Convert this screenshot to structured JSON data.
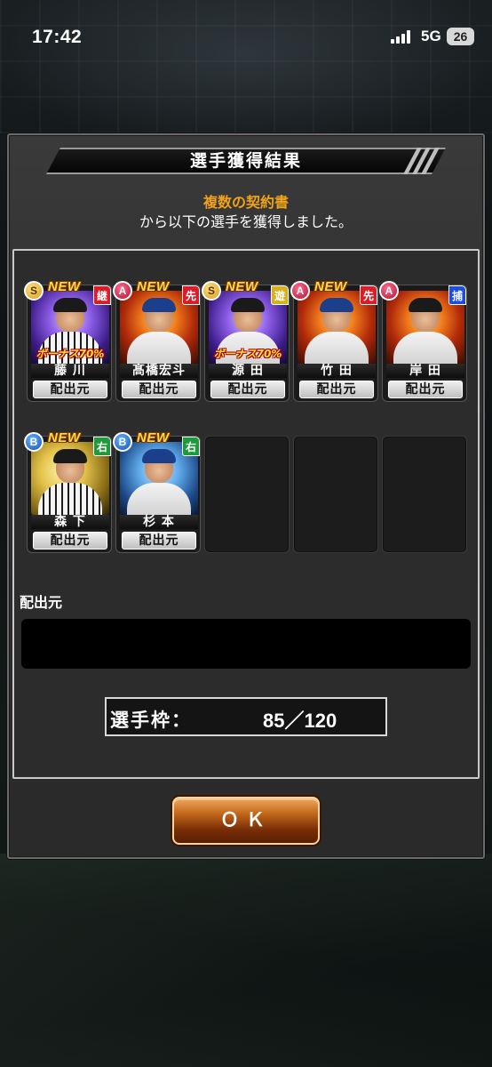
{
  "status_bar": {
    "time": "17:42",
    "network": "5G",
    "battery": "26"
  },
  "dialog": {
    "title": "選手獲得結果",
    "message_highlight": "複数の契約書",
    "message_body": "から以下の選手を獲得しました。"
  },
  "players": [
    {
      "name": "藤 川",
      "rank": "S",
      "position": "継",
      "position_color": "red",
      "new_label": "NEW",
      "bonus": "ボーナス70%",
      "theme": "purple",
      "source_button": "配出元"
    },
    {
      "name": "髙橋宏斗",
      "rank": "A",
      "position": "先",
      "position_color": "red",
      "new_label": "NEW",
      "bonus": "",
      "theme": "fire",
      "source_button": "配出元"
    },
    {
      "name": "源 田",
      "rank": "S",
      "position": "遊",
      "position_color": "yellow",
      "new_label": "NEW",
      "bonus": "ボーナス70%",
      "theme": "purple",
      "source_button": "配出元"
    },
    {
      "name": "竹 田",
      "rank": "A",
      "position": "先",
      "position_color": "red",
      "new_label": "NEW",
      "bonus": "",
      "theme": "fire",
      "source_button": "配出元"
    },
    {
      "name": "岸 田",
      "rank": "A",
      "position": "捕",
      "position_color": "blue",
      "new_label": "",
      "bonus": "",
      "theme": "fire",
      "source_button": "配出元"
    },
    {
      "name": "森 下",
      "rank": "B",
      "position": "右",
      "position_color": "green",
      "new_label": "NEW",
      "bonus": "",
      "theme": "gold",
      "source_button": "配出元"
    },
    {
      "name": "杉 本",
      "rank": "B",
      "position": "右",
      "position_color": "green",
      "new_label": "NEW",
      "bonus": "",
      "theme": "blue",
      "source_button": "配出元"
    }
  ],
  "source_section": {
    "label": "配出元",
    "value": ""
  },
  "roster": {
    "label": "選手枠：",
    "value": "85／120"
  },
  "ok_button": {
    "label": "ＯＫ"
  },
  "colors": {
    "highlight": "#f0a21a",
    "ok_button": "#c0661a"
  }
}
